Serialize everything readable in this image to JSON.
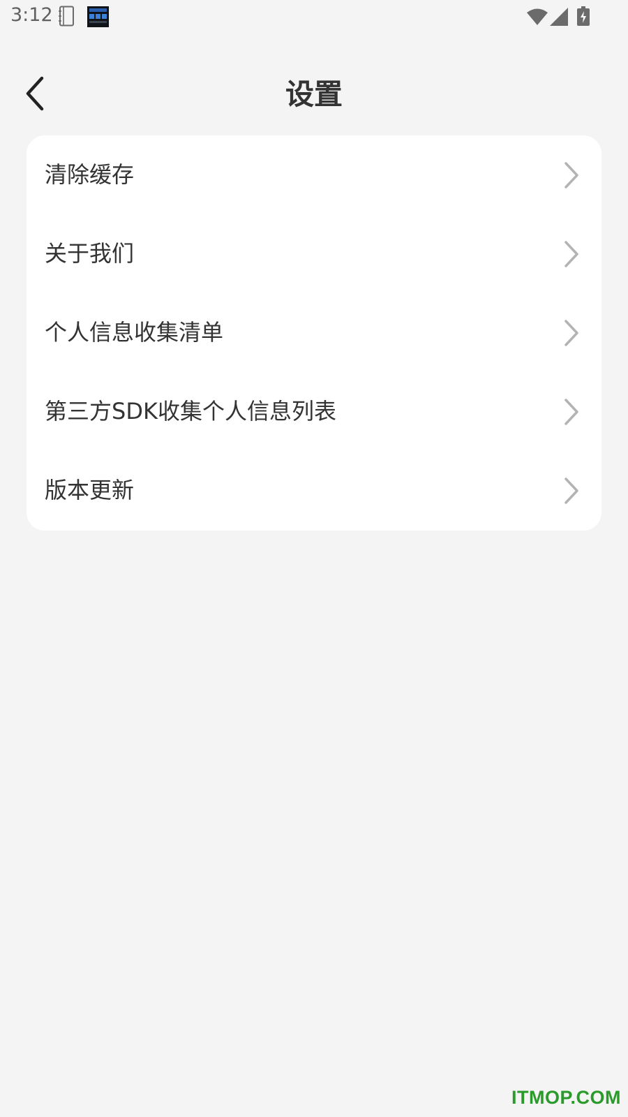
{
  "status_bar": {
    "time": "3:12",
    "icons": [
      "notebook-icon",
      "app-notification-icon",
      "wifi-icon",
      "signal-icon",
      "battery-charging-icon"
    ]
  },
  "header": {
    "title": "设置",
    "back_icon": "chevron-left-icon"
  },
  "settings": {
    "items": [
      {
        "label": "清除缓存",
        "icon": "chevron-right-icon"
      },
      {
        "label": "关于我们",
        "icon": "chevron-right-icon"
      },
      {
        "label": "个人信息收集清单",
        "icon": "chevron-right-icon"
      },
      {
        "label": "第三方SDK收集个人信息列表",
        "icon": "chevron-right-icon"
      },
      {
        "label": "版本更新",
        "icon": "chevron-right-icon"
      }
    ]
  },
  "watermark": "ITMOP.COM",
  "colors": {
    "background": "#f4f4f4",
    "card": "#ffffff",
    "text": "#333333",
    "chevron": "#b3b3b3",
    "watermark": "#2a9a2a"
  }
}
